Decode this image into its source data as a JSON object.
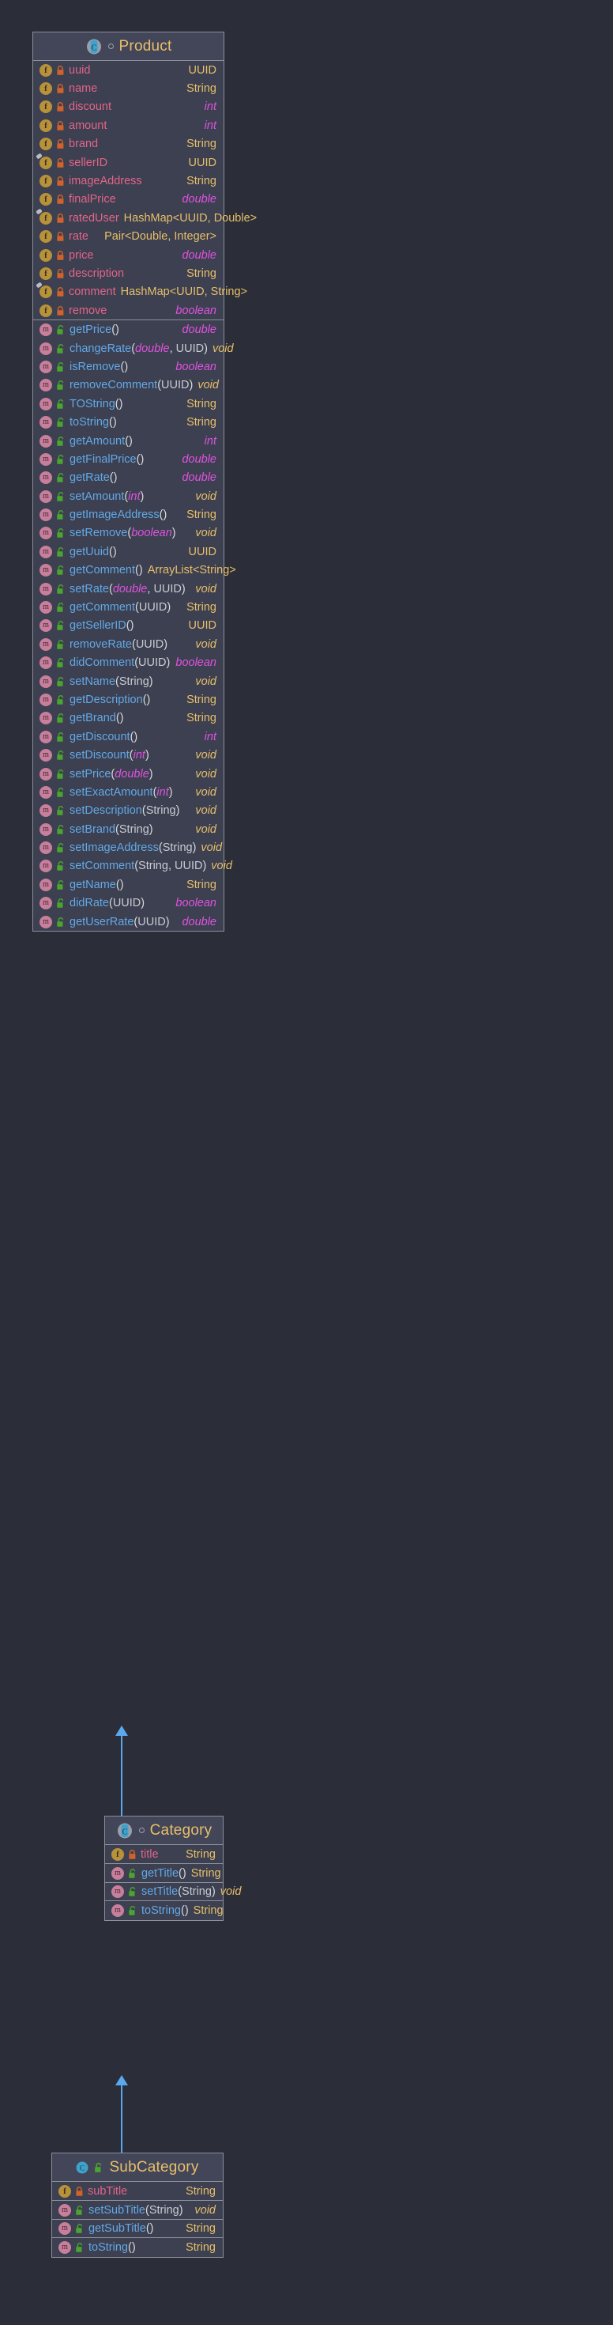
{
  "theme": {
    "background": "#2b2e38",
    "box_fill": "#3c4050",
    "header_fill": "#424658",
    "border": "#8a8f99",
    "class_title": "#e8bf6a",
    "field_name": "#e4648a",
    "method_name": "#63a8e8",
    "type_object": "#e8bf6a",
    "type_primitive": "#e152e0",
    "arrow": "#5aa9f0",
    "field_icon": "#b8923a",
    "method_icon": "#c77f9b",
    "lock_private": "#d2622a",
    "lock_public": "#4aa52e"
  },
  "diagram": {
    "type": "uml-class-diagram",
    "classes": [
      {
        "name": "Product",
        "icon": "abstract-class-icon",
        "modifier_icon": "circle-outline-icon",
        "fields": [
          {
            "icon": "field-icon",
            "visibility": "private",
            "static": false,
            "name": "uuid",
            "type": "UUID",
            "type_kind": "object"
          },
          {
            "icon": "field-icon",
            "visibility": "private",
            "static": false,
            "name": "name",
            "type": "String",
            "type_kind": "object"
          },
          {
            "icon": "field-icon",
            "visibility": "private",
            "static": false,
            "name": "discount",
            "type": "int",
            "type_kind": "primitive"
          },
          {
            "icon": "field-icon",
            "visibility": "private",
            "static": false,
            "name": "amount",
            "type": "int",
            "type_kind": "primitive"
          },
          {
            "icon": "field-icon",
            "visibility": "private",
            "static": false,
            "name": "brand",
            "type": "String",
            "type_kind": "object"
          },
          {
            "icon": "field-icon",
            "visibility": "private",
            "static": true,
            "name": "sellerID",
            "type": "UUID",
            "type_kind": "object"
          },
          {
            "icon": "field-icon",
            "visibility": "private",
            "static": false,
            "name": "imageAddress",
            "type": "String",
            "type_kind": "object"
          },
          {
            "icon": "field-icon",
            "visibility": "private",
            "static": false,
            "name": "finalPrice",
            "type": "double",
            "type_kind": "primitive"
          },
          {
            "icon": "field-icon",
            "visibility": "private",
            "static": true,
            "name": "ratedUser",
            "type": "HashMap<UUID, Double>",
            "type_kind": "object"
          },
          {
            "icon": "field-icon",
            "visibility": "private",
            "static": false,
            "name": "rate",
            "type": "Pair<Double, Integer>",
            "type_kind": "object"
          },
          {
            "icon": "field-icon",
            "visibility": "private",
            "static": false,
            "name": "price",
            "type": "double",
            "type_kind": "primitive"
          },
          {
            "icon": "field-icon",
            "visibility": "private",
            "static": false,
            "name": "description",
            "type": "String",
            "type_kind": "object"
          },
          {
            "icon": "field-icon",
            "visibility": "private",
            "static": true,
            "name": "comment",
            "type": "HashMap<UUID, String>",
            "type_kind": "object"
          },
          {
            "icon": "field-icon",
            "visibility": "private",
            "static": false,
            "name": "remove",
            "type": "boolean",
            "type_kind": "primitive"
          }
        ],
        "methods": [
          {
            "icon": "method-icon",
            "visibility": "public",
            "name": "getPrice",
            "params": "",
            "return": "double",
            "return_kind": "primitive"
          },
          {
            "icon": "method-icon",
            "visibility": "public",
            "name": "changeRate",
            "params": "double, UUID",
            "return": "void",
            "return_kind": "void"
          },
          {
            "icon": "method-icon",
            "visibility": "public",
            "name": "isRemove",
            "params": "",
            "return": "boolean",
            "return_kind": "primitive"
          },
          {
            "icon": "method-icon",
            "visibility": "public",
            "name": "removeComment",
            "params": "UUID",
            "return": "void",
            "return_kind": "void"
          },
          {
            "icon": "method-icon",
            "visibility": "public",
            "name": "TOString",
            "params": "",
            "return": "String",
            "return_kind": "object"
          },
          {
            "icon": "method-icon",
            "visibility": "public",
            "name": "toString",
            "params": "",
            "return": "String",
            "return_kind": "object"
          },
          {
            "icon": "method-icon",
            "visibility": "public",
            "name": "getAmount",
            "params": "",
            "return": "int",
            "return_kind": "primitive"
          },
          {
            "icon": "method-icon",
            "visibility": "public",
            "name": "getFinalPrice",
            "params": "",
            "return": "double",
            "return_kind": "primitive"
          },
          {
            "icon": "method-icon",
            "visibility": "public",
            "name": "getRate",
            "params": "",
            "return": "double",
            "return_kind": "primitive"
          },
          {
            "icon": "method-icon",
            "visibility": "public",
            "name": "setAmount",
            "params": "int",
            "return": "void",
            "return_kind": "void"
          },
          {
            "icon": "method-icon",
            "visibility": "public",
            "name": "getImageAddress",
            "params": "",
            "return": "String",
            "return_kind": "object"
          },
          {
            "icon": "method-icon",
            "visibility": "public",
            "name": "setRemove",
            "params": "boolean",
            "return": "void",
            "return_kind": "void"
          },
          {
            "icon": "method-icon",
            "visibility": "public",
            "name": "getUuid",
            "params": "",
            "return": "UUID",
            "return_kind": "object"
          },
          {
            "icon": "method-icon",
            "visibility": "public",
            "name": "getComment",
            "params": "",
            "return": "ArrayList<String>",
            "return_kind": "object"
          },
          {
            "icon": "method-icon",
            "visibility": "public",
            "name": "setRate",
            "params": "double, UUID",
            "return": "void",
            "return_kind": "void"
          },
          {
            "icon": "method-icon",
            "visibility": "public",
            "name": "getComment",
            "params": "UUID",
            "return": "String",
            "return_kind": "object"
          },
          {
            "icon": "method-icon",
            "visibility": "public",
            "name": "getSellerID",
            "params": "",
            "return": "UUID",
            "return_kind": "object"
          },
          {
            "icon": "method-icon",
            "visibility": "public",
            "name": "removeRate",
            "params": "UUID",
            "return": "void",
            "return_kind": "void"
          },
          {
            "icon": "method-icon",
            "visibility": "public",
            "name": "didComment",
            "params": "UUID",
            "return": "boolean",
            "return_kind": "primitive"
          },
          {
            "icon": "method-icon",
            "visibility": "public",
            "name": "setName",
            "params": "String",
            "return": "void",
            "return_kind": "void"
          },
          {
            "icon": "method-icon",
            "visibility": "public",
            "name": "getDescription",
            "params": "",
            "return": "String",
            "return_kind": "object"
          },
          {
            "icon": "method-icon",
            "visibility": "public",
            "name": "getBrand",
            "params": "",
            "return": "String",
            "return_kind": "object"
          },
          {
            "icon": "method-icon",
            "visibility": "public",
            "name": "getDiscount",
            "params": "",
            "return": "int",
            "return_kind": "primitive"
          },
          {
            "icon": "method-icon",
            "visibility": "public",
            "name": "setDiscount",
            "params": "int",
            "return": "void",
            "return_kind": "void"
          },
          {
            "icon": "method-icon",
            "visibility": "public",
            "name": "setPrice",
            "params": "double",
            "return": "void",
            "return_kind": "void"
          },
          {
            "icon": "method-icon",
            "visibility": "public",
            "name": "setExactAmount",
            "params": "int",
            "return": "void",
            "return_kind": "void"
          },
          {
            "icon": "method-icon",
            "visibility": "public",
            "name": "setDescription",
            "params": "String",
            "return": "void",
            "return_kind": "void"
          },
          {
            "icon": "method-icon",
            "visibility": "public",
            "name": "setBrand",
            "params": "String",
            "return": "void",
            "return_kind": "void"
          },
          {
            "icon": "method-icon",
            "visibility": "public",
            "name": "setImageAddress",
            "params": "String",
            "return": "void",
            "return_kind": "void"
          },
          {
            "icon": "method-icon",
            "visibility": "public",
            "name": "setComment",
            "params": "String, UUID",
            "return": "void",
            "return_kind": "void"
          },
          {
            "icon": "method-icon",
            "visibility": "public",
            "name": "getName",
            "params": "",
            "return": "String",
            "return_kind": "object"
          },
          {
            "icon": "method-icon",
            "visibility": "public",
            "name": "didRate",
            "params": "UUID",
            "return": "boolean",
            "return_kind": "primitive"
          },
          {
            "icon": "method-icon",
            "visibility": "public",
            "name": "getUserRate",
            "params": "UUID",
            "return": "double",
            "return_kind": "primitive"
          }
        ]
      },
      {
        "name": "Category",
        "icon": "abstract-class-icon",
        "modifier_icon": "circle-outline-icon",
        "fields": [
          {
            "icon": "field-icon",
            "visibility": "private",
            "static": false,
            "name": "title",
            "type": "String",
            "type_kind": "object"
          }
        ],
        "methods": [
          {
            "icon": "method-icon",
            "visibility": "public",
            "name": "getTitle",
            "params": "",
            "return": "String",
            "return_kind": "object"
          },
          {
            "icon": "method-icon",
            "visibility": "public",
            "name": "setTitle",
            "params": "String",
            "return": "void",
            "return_kind": "void"
          },
          {
            "icon": "method-icon",
            "visibility": "public",
            "name": "toString",
            "params": "",
            "return": "String",
            "return_kind": "object"
          }
        ]
      },
      {
        "name": "SubCategory",
        "icon": "class-icon",
        "modifier_icon": "lock-open-icon",
        "fields": [
          {
            "icon": "field-icon",
            "visibility": "private",
            "static": false,
            "name": "subTitle",
            "type": "String",
            "type_kind": "object"
          }
        ],
        "methods": [
          {
            "icon": "method-icon",
            "visibility": "public",
            "name": "setSubTitle",
            "params": "String",
            "return": "void",
            "return_kind": "void"
          },
          {
            "icon": "method-icon",
            "visibility": "public",
            "name": "getSubTitle",
            "params": "",
            "return": "String",
            "return_kind": "object"
          },
          {
            "icon": "method-icon",
            "visibility": "public",
            "name": "toString",
            "params": "",
            "return": "String",
            "return_kind": "object"
          }
        ]
      }
    ],
    "relations": [
      {
        "kind": "generalization",
        "from": "Category",
        "to": "Product",
        "arrow": "inheritance-arrow"
      },
      {
        "kind": "generalization",
        "from": "SubCategory",
        "to": "Category",
        "arrow": "inheritance-arrow"
      }
    ]
  }
}
